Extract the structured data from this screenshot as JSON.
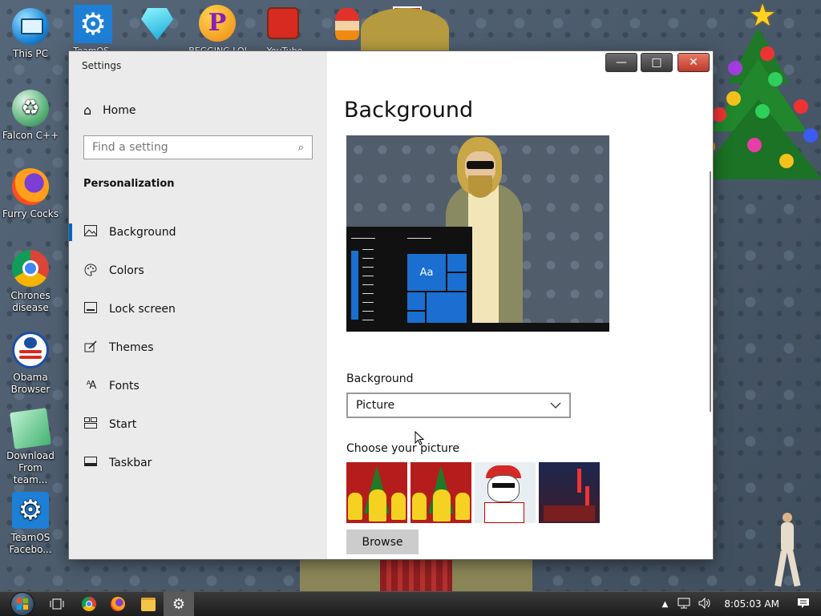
{
  "desktop": {
    "left_icons": [
      {
        "label": "This PC",
        "icon": "monitor-icon"
      },
      {
        "label": "Falcon C++",
        "icon": "recycle-icon"
      },
      {
        "label": "Furry Cocks",
        "icon": "firefox-icon"
      },
      {
        "label": "Chrones disease",
        "icon": "chrome-icon"
      },
      {
        "label": "Obama Browser",
        "icon": "obama-logo-icon"
      },
      {
        "label": "Download From team...",
        "icon": "notepad-icon"
      },
      {
        "label": "TeamOS Facebo...",
        "icon": "gear-icon"
      }
    ],
    "top_icons": [
      {
        "label": "TeamOS...",
        "icon": "gear-icon"
      },
      {
        "label": "...",
        "icon": "gem-icon"
      },
      {
        "label": "BEGGING LOL",
        "icon": "p-logo-icon"
      },
      {
        "label": "YouTube",
        "icon": "angry-bird-icon"
      },
      {
        "label": "...",
        "icon": "santa-icon"
      },
      {
        "label": "...",
        "icon": "gift-icon"
      }
    ]
  },
  "window": {
    "title": "Settings",
    "controls": {
      "minimize": "—",
      "maximize": "□",
      "close": "✕"
    },
    "sidebar": {
      "home_label": "Home",
      "search_placeholder": "Find a setting",
      "section_title": "Personalization",
      "items": [
        {
          "label": "Background",
          "icon": "picture-icon",
          "active": true
        },
        {
          "label": "Colors",
          "icon": "palette-icon",
          "active": false
        },
        {
          "label": "Lock screen",
          "icon": "lock-screen-icon",
          "active": false
        },
        {
          "label": "Themes",
          "icon": "brush-icon",
          "active": false
        },
        {
          "label": "Fonts",
          "icon": "fonts-icon",
          "active": false
        },
        {
          "label": "Start",
          "icon": "start-icon",
          "active": false
        },
        {
          "label": "Taskbar",
          "icon": "taskbar-icon",
          "active": false
        }
      ]
    },
    "content": {
      "title": "Background",
      "preview_tile_text": "Aa",
      "background_label": "Background",
      "background_value": "Picture",
      "choose_picture_label": "Choose your picture",
      "browse_label": "Browse"
    }
  },
  "taskbar": {
    "clock": "8:05:03 AM",
    "items": [
      "start-orb-icon",
      "task-view-icon",
      "chrome-icon",
      "firefox-icon",
      "folder-icon",
      "settings-icon"
    ]
  }
}
